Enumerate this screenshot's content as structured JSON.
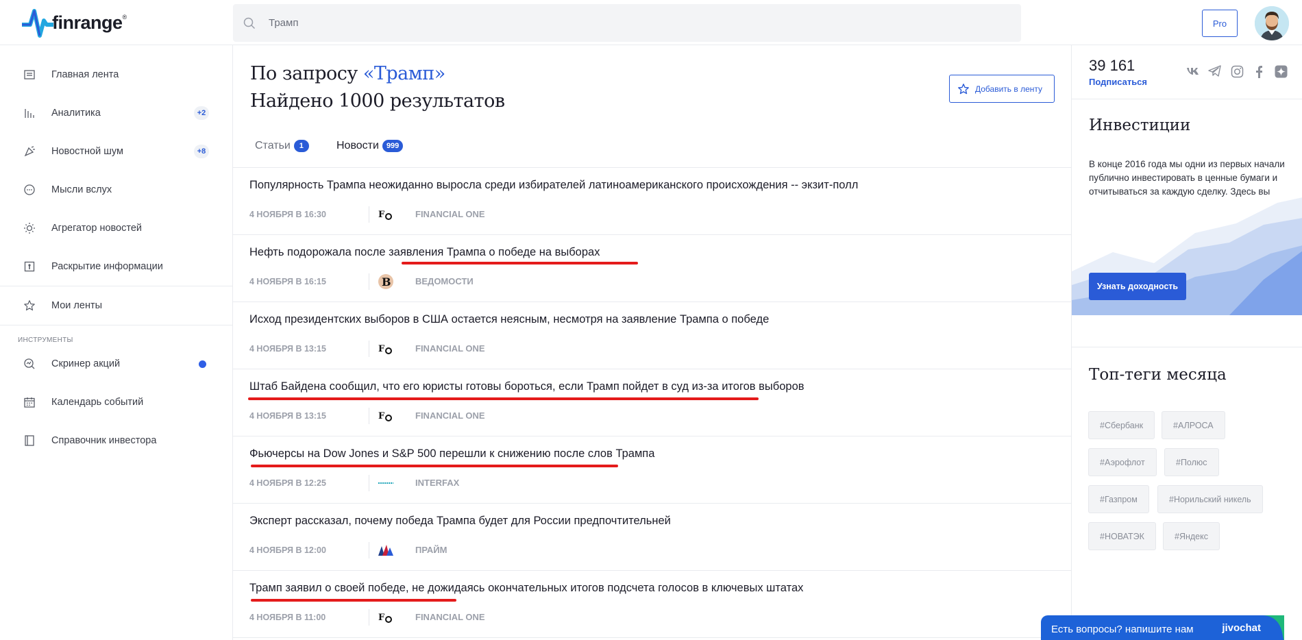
{
  "header": {
    "logo_text": "finrange",
    "logo_reg": "®",
    "search_value": "Трамп",
    "pro_label": "Pro"
  },
  "sidebar": {
    "items": [
      {
        "label": "Главная лента",
        "icon": "news-icon"
      },
      {
        "label": "Аналитика",
        "icon": "analytics-icon",
        "badge": "+2"
      },
      {
        "label": "Новостной шум",
        "icon": "noise-icon",
        "badge": "+8"
      },
      {
        "label": "Мысли вслух",
        "icon": "chat-bubble-icon"
      },
      {
        "label": "Агрегатор новостей",
        "icon": "sun-icon"
      },
      {
        "label": "Раскрытие информации",
        "icon": "disclosure-icon"
      },
      {
        "label": "Мои ленты",
        "icon": "star-icon"
      }
    ],
    "section_title": "ИНСТРУМЕНТЫ",
    "tools": [
      {
        "label": "Скринер акций",
        "icon": "screener-icon"
      },
      {
        "label": "Календарь событий",
        "icon": "calendar-icon"
      },
      {
        "label": "Справочник инвестора",
        "icon": "book-icon"
      }
    ]
  },
  "main": {
    "query_prefix": "По запросу ",
    "query_term": "«Трамп»",
    "results": "Найдено 1000 результатов",
    "add_feed_label": "Добавить в ленту",
    "tabs": [
      {
        "label": "Статьи",
        "badge": "1"
      },
      {
        "label": "Новости",
        "badge": "999"
      }
    ],
    "news": [
      {
        "title": "Популярность Трампа неожиданно выросла среди избирателей латиноамериканского происхождения -- экзит-полл",
        "date": "4 НОЯБРЯ В 16:30",
        "source": "FINANCIAL ONE"
      },
      {
        "title": "Нефть подорожала после заявления Трампа о победе на выборах",
        "date": "4 НОЯБРЯ В 16:15",
        "source": "ВЕДОМОСТИ"
      },
      {
        "title": "Исход президентских выборов в США остается неясным, несмотря на заявление Трампа о победе",
        "date": "4 НОЯБРЯ В 13:15",
        "source": "FINANCIAL ONE"
      },
      {
        "title": "Штаб Байдена сообщил, что его юристы готовы бороться, если Трамп пойдет в суд из-за итогов выборов",
        "date": "4 НОЯБРЯ В 13:15",
        "source": "FINANCIAL ONE"
      },
      {
        "title": "Фьючерсы на Dow Jones и S&P 500 перешли к снижению после слов Трампа",
        "date": "4 НОЯБРЯ В 12:25",
        "source": "INTERFAX"
      },
      {
        "title": "Эксперт рассказал, почему победа Трампа будет для России предпочтительней",
        "date": "4 НОЯБРЯ В 12:00",
        "source": "ПРАЙМ"
      },
      {
        "title": "Трамп заявил о своей победе, не дожидаясь окончательных итогов подсчета голосов в ключевых штатах",
        "date": "4 НОЯБРЯ В 11:00",
        "source": "FINANCIAL ONE"
      }
    ]
  },
  "right": {
    "subscribers": "39 161",
    "subscribe_label": "Подписаться",
    "invest_title": "Инвестиции",
    "invest_text": "В конце 2016 года мы одни из первых начали публично инвестировать в ценные бумаги и отчитываться за каждую сделку. Здесь вы можете посмотреть, чем всё это обернулось.",
    "invest_button": "Узнать доходность",
    "tags_title": "Топ-теги месяца",
    "tags": [
      "#Сбербанк",
      "#АЛРОСА",
      "#Аэрофлот",
      "#Полюс",
      "#Газпром",
      "#Норильский никель",
      "#НОВАТЭК",
      "#Яндекс"
    ]
  },
  "chat": {
    "text": "Есть вопросы? напишите нам",
    "brand": "jivochat"
  },
  "colors": {
    "accent": "#2a5bd7",
    "underline": "#e41b1b",
    "chat": "#1d62d8"
  }
}
